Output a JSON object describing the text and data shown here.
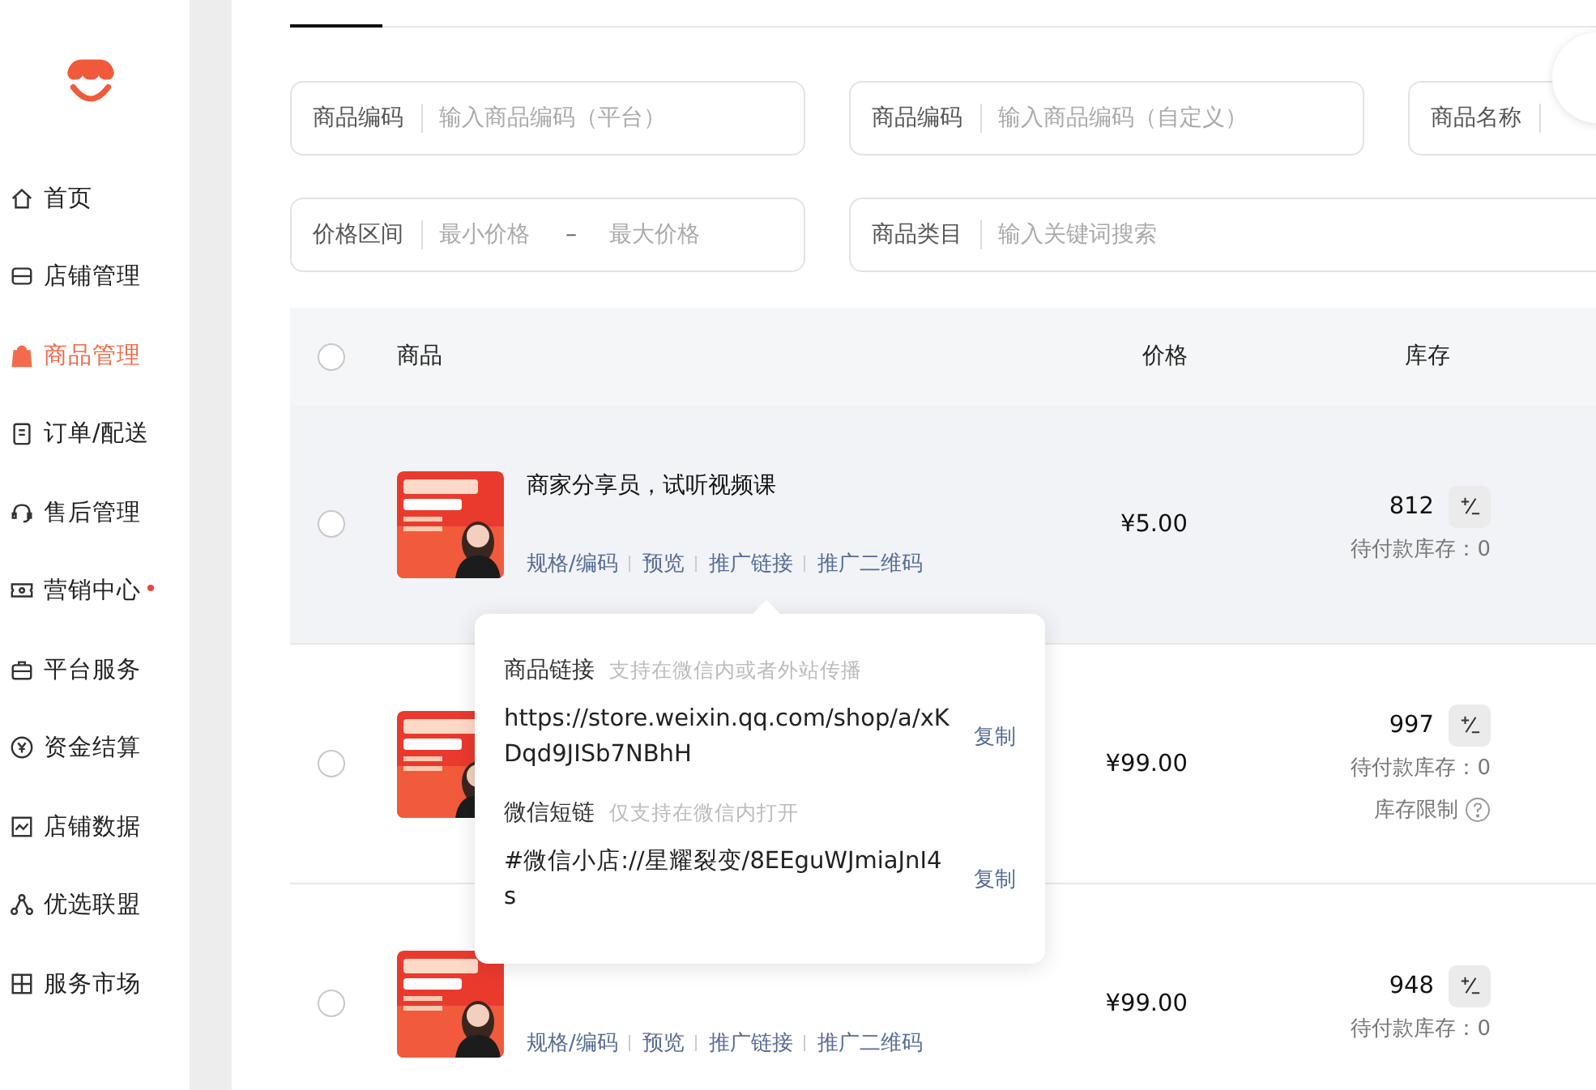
{
  "sidebar": {
    "items": [
      {
        "label": "首页",
        "selected": false,
        "dot": false
      },
      {
        "label": "店铺管理",
        "selected": false,
        "dot": false
      },
      {
        "label": "商品管理",
        "selected": true,
        "dot": false
      },
      {
        "label": "订单/配送",
        "selected": false,
        "dot": false
      },
      {
        "label": "售后管理",
        "selected": false,
        "dot": false
      },
      {
        "label": "营销中心",
        "selected": false,
        "dot": true
      },
      {
        "label": "平台服务",
        "selected": false,
        "dot": false
      },
      {
        "label": "资金结算",
        "selected": false,
        "dot": false
      },
      {
        "label": "店铺数据",
        "selected": false,
        "dot": false
      },
      {
        "label": "优选联盟",
        "selected": false,
        "dot": false
      },
      {
        "label": "服务市场",
        "selected": false,
        "dot": false
      }
    ]
  },
  "filters": [
    {
      "kind": "text",
      "label": "商品编码",
      "placeholder": "输入商品编码（平台）"
    },
    {
      "kind": "text",
      "label": "商品编码",
      "placeholder": "输入商品编码（自定义）"
    },
    {
      "kind": "text",
      "label": "商品名称"
    },
    {
      "kind": "range",
      "label": "价格区间",
      "min": {
        "placeholder": "最小价格"
      },
      "separator": "–",
      "max": {
        "placeholder": "最大价格"
      }
    },
    {
      "kind": "wide",
      "label": "商品类目",
      "placeholder": "输入关键词搜索"
    }
  ],
  "table": {
    "all_checked": false,
    "columns": [
      "商品",
      "价格",
      "库存"
    ],
    "rows": [
      {
        "highlighted": true,
        "checked": false,
        "title": "商家分享员，试听视频课",
        "actions": [
          "规格/编码",
          "预览",
          "推广链接",
          "推广二维码"
        ],
        "price": "¥5.00",
        "stock": "812",
        "pending": "待付款库存：0"
      },
      {
        "highlighted": false,
        "checked": false,
        "price": "¥99.00",
        "stock": "997",
        "pending": "待付款库存：0",
        "limit": "库存限制"
      },
      {
        "highlighted": false,
        "checked": false,
        "actions": [
          "规格/编码",
          "预览",
          "推广链接",
          "推广二维码"
        ],
        "price": "¥99.00",
        "stock": "948",
        "pending": "待付款库存：0"
      }
    ]
  },
  "popup": {
    "sections": [
      {
        "title": "商品链接",
        "hint": "支持在微信内或者外站传播",
        "value": "https://store.weixin.qq.com/shop/a/xKDqd9JISb7NBhH",
        "action": "复制"
      },
      {
        "title": "微信短链",
        "hint": "仅支持在微信内打开",
        "value": "#微信小店://星耀裂变/8EEguWJmiaJnI4s",
        "action": "复制"
      }
    ]
  }
}
